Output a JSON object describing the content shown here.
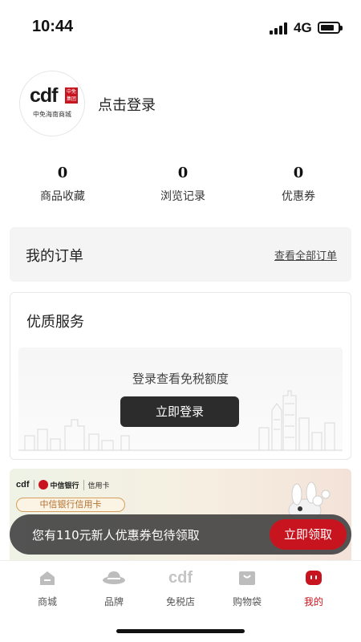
{
  "status_bar": {
    "time": "10:44",
    "network": "4G"
  },
  "profile": {
    "logo_text": "cdf",
    "logo_badge": "中免集团",
    "logo_subtitle": "中免海南商城",
    "login_prompt": "点击登录"
  },
  "stats": [
    {
      "value": "0",
      "label": "商品收藏"
    },
    {
      "value": "0",
      "label": "浏览记录"
    },
    {
      "value": "0",
      "label": "优惠券"
    }
  ],
  "orders": {
    "title": "我的订单",
    "view_all": "查看全部订单"
  },
  "service": {
    "title": "优质服务",
    "hint": "登录查看免税额度",
    "login_button": "立即登录"
  },
  "banner": {
    "brand": "cdf",
    "bank": "中信银行",
    "card_tag": "信用卡",
    "pill": "中信银行信用卡"
  },
  "toast": {
    "text": "您有110元新人优惠券包待领取",
    "button": "立即领取"
  },
  "tabbar": {
    "active_color": "#c8141e",
    "items": [
      {
        "label": "商城",
        "icon": "mall-icon"
      },
      {
        "label": "品牌",
        "icon": "brand-icon"
      },
      {
        "label": "免税店",
        "icon": "cdf-store-icon"
      },
      {
        "label": "购物袋",
        "icon": "shopping-bag-icon"
      },
      {
        "label": "我的",
        "icon": "profile-icon",
        "active": true
      }
    ]
  }
}
